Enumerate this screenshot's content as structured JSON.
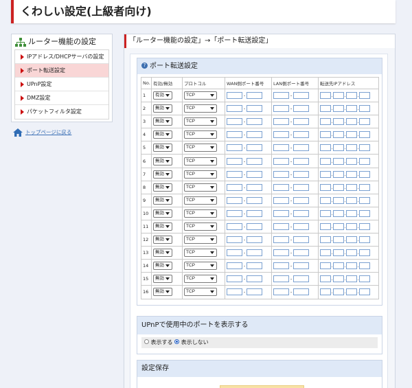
{
  "page": {
    "title": "くわしい設定(上級者向け)"
  },
  "sidebar": {
    "title": "ルーター機能の設定",
    "items": [
      {
        "label": "IPアドレス/DHCPサーバの設定",
        "active": false
      },
      {
        "label": "ポート転送設定",
        "active": true
      },
      {
        "label": "UPnP設定",
        "active": false
      },
      {
        "label": "DMZ設定",
        "active": false
      },
      {
        "label": "パケットフィルタ設定",
        "active": false
      }
    ],
    "home_link": "トップページに戻る"
  },
  "main": {
    "breadcrumb": "「ルーター機能の設定」→「ポート転送設定」",
    "port_forward": {
      "title": "ポート転送設定",
      "columns": [
        "No.",
        "有効/無効",
        "プロトコル",
        "WAN側ポート番号",
        "LAN側ポート番号",
        "転送先IPアドレス"
      ],
      "rows": [
        {
          "no": "1",
          "enabled": "有効",
          "protocol": "TCP"
        },
        {
          "no": "2",
          "enabled": "無効",
          "protocol": "TCP"
        },
        {
          "no": "3",
          "enabled": "無効",
          "protocol": "TCP"
        },
        {
          "no": "4",
          "enabled": "無効",
          "protocol": "TCP"
        },
        {
          "no": "5",
          "enabled": "無効",
          "protocol": "TCP"
        },
        {
          "no": "6",
          "enabled": "無効",
          "protocol": "TCP"
        },
        {
          "no": "7",
          "enabled": "無効",
          "protocol": "TCP"
        },
        {
          "no": "8",
          "enabled": "無効",
          "protocol": "TCP"
        },
        {
          "no": "9",
          "enabled": "無効",
          "protocol": "TCP"
        },
        {
          "no": "10",
          "enabled": "無効",
          "protocol": "TCP"
        },
        {
          "no": "11",
          "enabled": "無効",
          "protocol": "TCP"
        },
        {
          "no": "12",
          "enabled": "無効",
          "protocol": "TCP"
        },
        {
          "no": "13",
          "enabled": "無効",
          "protocol": "TCP"
        },
        {
          "no": "14",
          "enabled": "無効",
          "protocol": "TCP"
        },
        {
          "no": "15",
          "enabled": "無効",
          "protocol": "TCP"
        },
        {
          "no": "16",
          "enabled": "無効",
          "protocol": "TCP"
        }
      ]
    },
    "upnp": {
      "title": "UPnPで使用中のポートを表示する",
      "option_show": "表示する",
      "option_hide": "表示しない",
      "selected": "表示しない"
    },
    "save": {
      "title": "設定保存"
    }
  },
  "colors": {
    "accent": "#cc2222",
    "section_header": "#dfe9f7",
    "active_nav": "#f9d6d6",
    "link": "#3a6fb5"
  }
}
